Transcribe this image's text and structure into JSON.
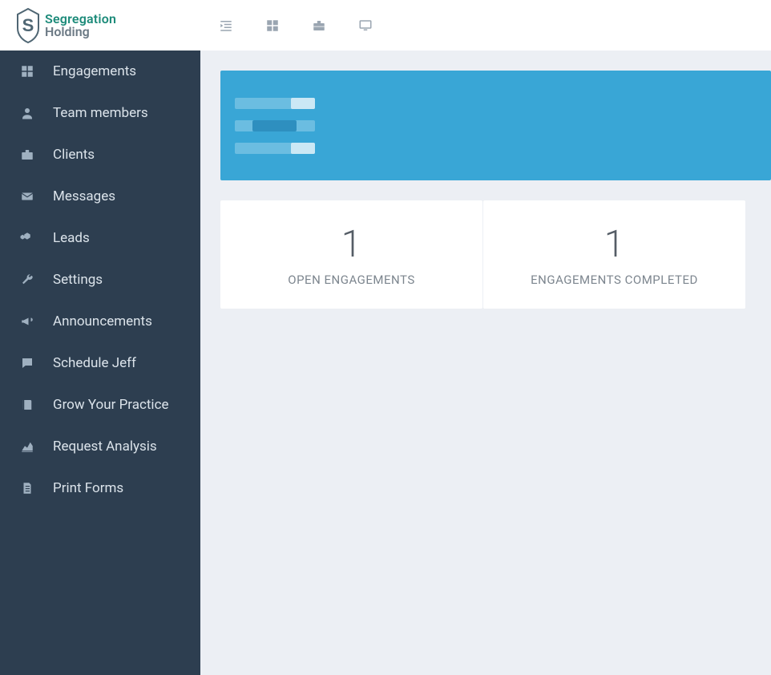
{
  "brand": {
    "name1": "Segregation",
    "name2": "Holding"
  },
  "sidebar": {
    "items": [
      {
        "label": "Engagements",
        "icon": "grid-icon"
      },
      {
        "label": "Team members",
        "icon": "user-icon"
      },
      {
        "label": "Clients",
        "icon": "briefcase-icon"
      },
      {
        "label": "Messages",
        "icon": "envelope-icon"
      },
      {
        "label": "Leads",
        "icon": "cubes-icon"
      },
      {
        "label": "Settings",
        "icon": "wrench-icon"
      },
      {
        "label": "Announcements",
        "icon": "bullhorn-icon"
      },
      {
        "label": "Schedule Jeff",
        "icon": "comment-icon"
      },
      {
        "label": "Grow Your Practice",
        "icon": "book-icon"
      },
      {
        "label": "Request Analysis",
        "icon": "areachart-icon"
      },
      {
        "label": "Print Forms",
        "icon": "document-icon"
      }
    ]
  },
  "stats": {
    "open": {
      "value": "1",
      "label": "OPEN ENGAGEMENTS"
    },
    "completed": {
      "value": "1",
      "label": "ENGAGEMENTS COMPLETED"
    }
  }
}
